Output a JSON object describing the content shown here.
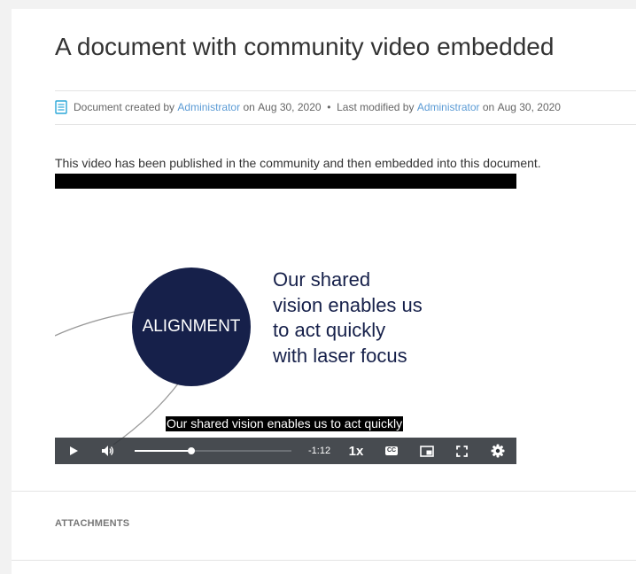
{
  "document": {
    "title": "A document with community video embedded",
    "meta": {
      "created_prefix": "Document created by",
      "created_by": "Administrator",
      "created_on_prefix": "on",
      "created_date": "Aug 30, 2020",
      "separator": "•",
      "modified_prefix": "Last modified by",
      "modified_by": "Administrator",
      "modified_on_prefix": "on",
      "modified_date": "Aug 30, 2020"
    },
    "body_text": "This video has been published in the community and then embedded into this document."
  },
  "video": {
    "slide": {
      "circle_label": "ALIGNMENT",
      "lines": [
        "Our shared",
        "vision enables us",
        "to act quickly",
        "with laser focus"
      ]
    },
    "caption": "Our shared vision enables us to act quickly",
    "controls": {
      "time_remaining": "-1:12",
      "speed": "1x",
      "cc_label": "CC",
      "progress_fraction": 0.36,
      "icons": [
        "play-icon",
        "volume-icon",
        "captions-icon",
        "picture-in-picture-icon",
        "fullscreen-icon",
        "settings-icon"
      ]
    }
  },
  "attachments": {
    "title": "ATTACHMENTS"
  },
  "colors": {
    "link": "#5b9bd5",
    "slide_navy": "#16204a",
    "control_bar": "#2d3238",
    "doc_icon": "#2aa7d8"
  }
}
